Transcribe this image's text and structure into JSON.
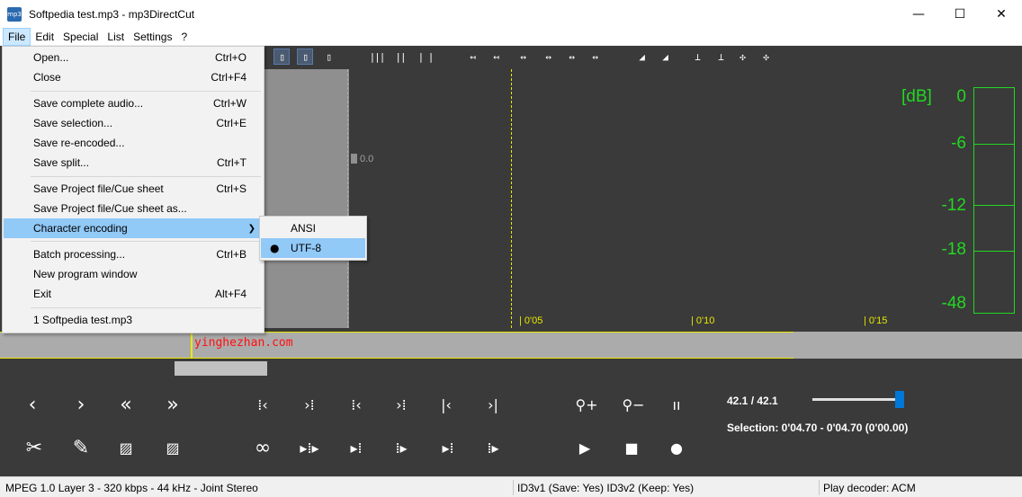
{
  "window": {
    "app_icon_text": "mp3",
    "title": "Softpedia test.mp3 - mp3DirectCut",
    "minimize": "—",
    "maximize": "☐",
    "close": "✕"
  },
  "menubar": [
    "File",
    "Edit",
    "Special",
    "List",
    "Settings",
    "?"
  ],
  "file_menu": {
    "open": {
      "label": "Open...",
      "shortcut": "Ctrl+O"
    },
    "close": {
      "label": "Close",
      "shortcut": "Ctrl+F4"
    },
    "save_complete": {
      "label": "Save complete audio...",
      "shortcut": "Ctrl+W"
    },
    "save_selection": {
      "label": "Save selection...",
      "shortcut": "Ctrl+E"
    },
    "save_reencoded": {
      "label": "Save re-encoded..."
    },
    "save_split": {
      "label": "Save split...",
      "shortcut": "Ctrl+T"
    },
    "save_project": {
      "label": "Save Project file/Cue sheet",
      "shortcut": "Ctrl+S"
    },
    "save_project_as": {
      "label": "Save Project file/Cue sheet as..."
    },
    "char_encoding": {
      "label": "Character encoding",
      "arrow": "❯"
    },
    "batch": {
      "label": "Batch processing...",
      "shortcut": "Ctrl+B"
    },
    "new_window": {
      "label": "New program window"
    },
    "exit": {
      "label": "Exit",
      "shortcut": "Alt+F4"
    },
    "recent_1": {
      "label": "1 Softpedia test.mp3"
    }
  },
  "encoding_submenu": {
    "ansi": "ANSI",
    "utf8": "UTF-8",
    "selected_bullet": "●"
  },
  "waveform": {
    "level_marker": "0.0",
    "time_ticks": [
      "| 0'05",
      "| 0'10",
      "| 0'15"
    ],
    "watermark": "yinghezhan.com"
  },
  "level_meter": {
    "unit": "[dB]",
    "labels": [
      "0",
      "-6",
      "-12",
      "-18",
      "-48"
    ]
  },
  "controls": {
    "position": "42.1  /  42.1",
    "selection": "Selection: 0'04.70 - 0'04.70 (0'00.00)",
    "volume_level": 0.97
  },
  "statusbar": {
    "format": "MPEG 1.0 Layer 3  -  320 kbps  -  44 kHz  -  Joint Stereo",
    "id3": "ID3v1 (Save: Yes)   ID3v2 (Keep: Yes)",
    "decoder": "Play decoder: ACM"
  },
  "colors": {
    "background_dark": "#3a3a3a",
    "meter_green": "#22d822",
    "cursor_yellow": "#e8e800",
    "menu_highlight": "#91c9f7"
  }
}
